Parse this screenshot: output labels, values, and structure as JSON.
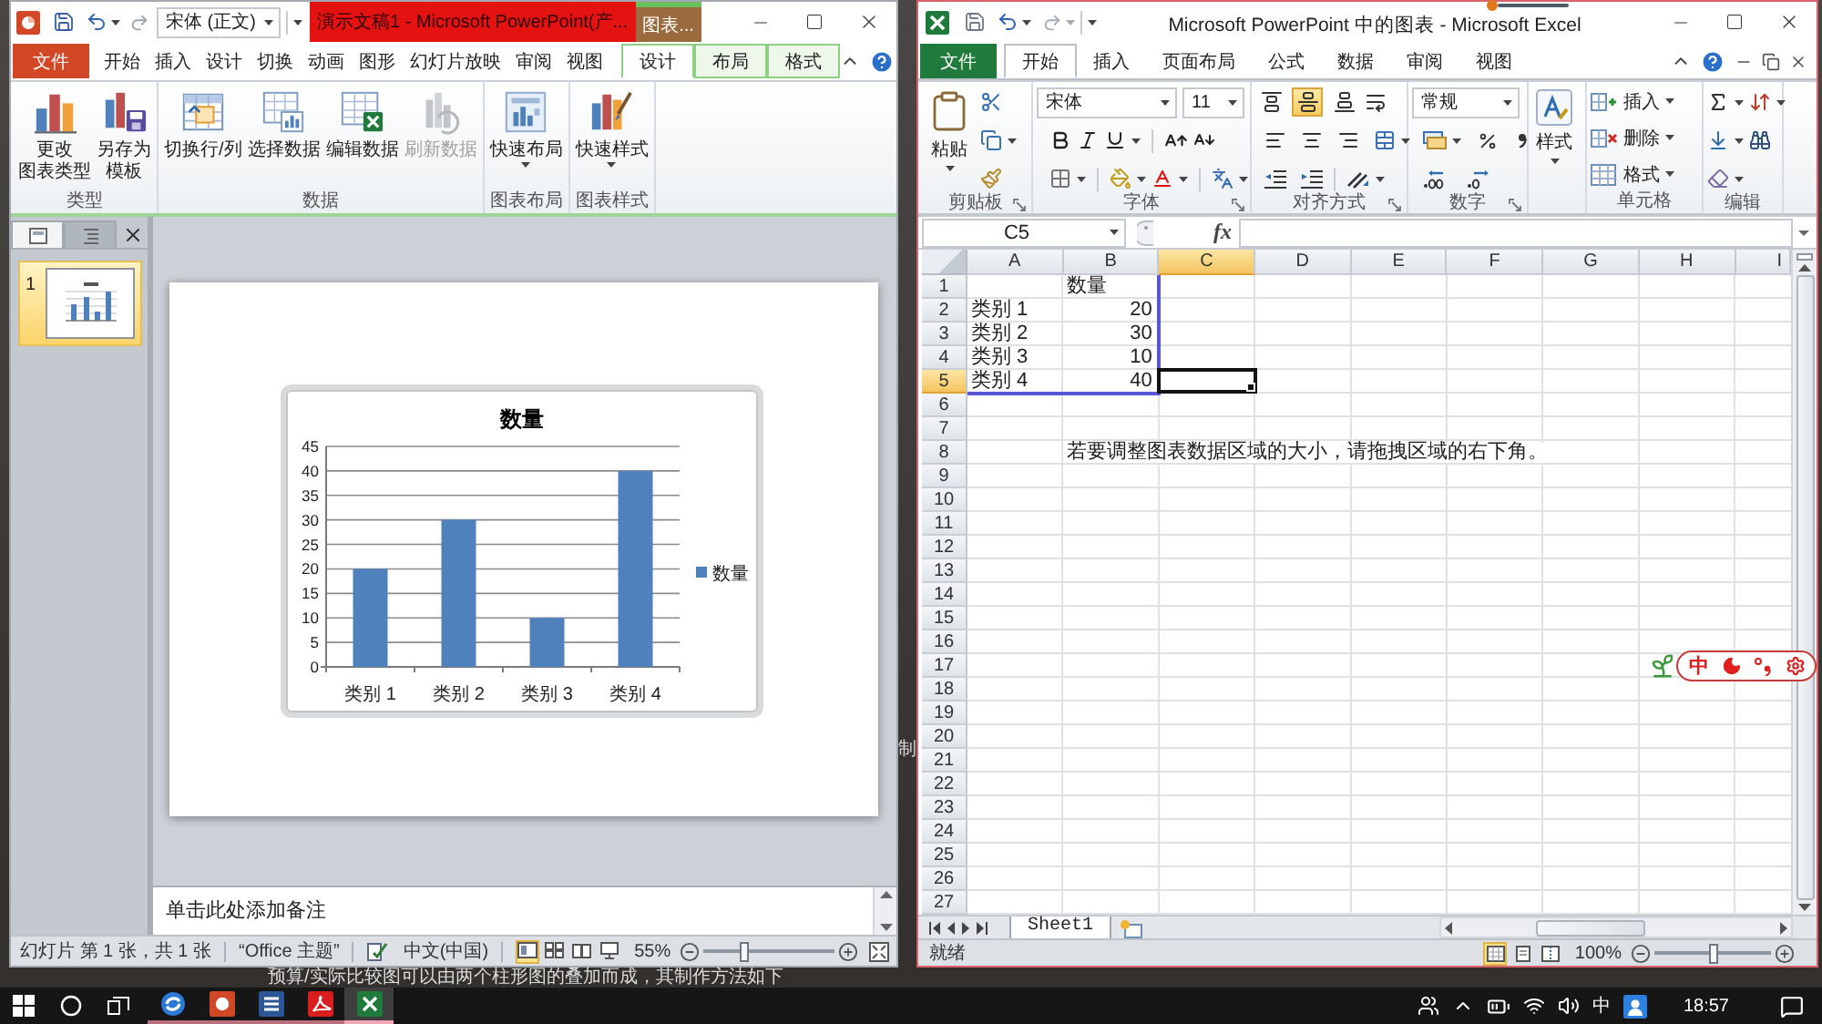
{
  "powerpoint": {
    "font_box": "宋体 (正文)",
    "title": "演示文稿1 - Microsoft PowerPoint(产...",
    "context_title": "图表...",
    "tabs": [
      {
        "label": "文件",
        "kind": "file",
        "selected": false
      },
      {
        "label": "开始",
        "kind": "main",
        "selected": false
      },
      {
        "label": "插入",
        "kind": "main",
        "selected": false
      },
      {
        "label": "设计",
        "kind": "main",
        "selected": false
      },
      {
        "label": "切换",
        "kind": "main",
        "selected": false
      },
      {
        "label": "动画",
        "kind": "main",
        "selected": false
      },
      {
        "label": "图形",
        "kind": "main",
        "selected": false
      },
      {
        "label": "幻灯片放映",
        "kind": "main",
        "selected": false
      },
      {
        "label": "审阅",
        "kind": "main",
        "selected": false
      },
      {
        "label": "视图",
        "kind": "main",
        "selected": false
      },
      {
        "label": "设计",
        "kind": "context",
        "selected": true
      },
      {
        "label": "布局",
        "kind": "context",
        "selected": false
      },
      {
        "label": "格式",
        "kind": "context",
        "selected": false
      }
    ],
    "ribbon_groups": [
      {
        "label": "类型",
        "buttons": [
          {
            "lines": [
              "更改",
              "图表类型"
            ],
            "dropdown": false,
            "disabled": false
          },
          {
            "lines": [
              "另存为",
              "模板"
            ],
            "dropdown": false,
            "disabled": false
          }
        ]
      },
      {
        "label": "数据",
        "buttons": [
          {
            "lines": [
              "切换行/列"
            ],
            "dropdown": false,
            "disabled": false
          },
          {
            "lines": [
              "选择数据"
            ],
            "dropdown": false,
            "disabled": false
          },
          {
            "lines": [
              "编辑数据"
            ],
            "dropdown": false,
            "disabled": false
          },
          {
            "lines": [
              "刷新数据"
            ],
            "dropdown": false,
            "disabled": true
          }
        ]
      },
      {
        "label": "图表布局",
        "buttons": [
          {
            "lines": [
              "快速布局"
            ],
            "dropdown": true,
            "disabled": false
          }
        ]
      },
      {
        "label": "图表样式",
        "buttons": [
          {
            "lines": [
              "快速样式"
            ],
            "dropdown": true,
            "disabled": false
          }
        ]
      }
    ],
    "pane_tabs": [
      {
        "selected": true
      },
      {
        "selected": false
      }
    ],
    "slides": [
      {
        "number": "1",
        "selected": true
      }
    ],
    "chart": {
      "chart_data": {
        "type": "bar",
        "title": "数量",
        "categories": [
          "类别 1",
          "类别 2",
          "类别 3",
          "类别 4"
        ],
        "series": [
          {
            "name": "数量",
            "color": "#4f81bd",
            "values": [
              20,
              30,
              10,
              40
            ]
          }
        ],
        "ylim": [
          0,
          45
        ],
        "yticks": [
          0,
          5,
          10,
          15,
          20,
          25,
          30,
          35,
          40,
          45
        ],
        "grid": true
      }
    },
    "notes": {
      "placeholder": "单击此处添加备注"
    },
    "status_bar": {
      "slide": "幻灯片 第 1 张，共 1 张",
      "theme": "“Office 主题”",
      "language": "中文(中国)",
      "views": [
        {
          "selected": true
        },
        {
          "selected": false
        },
        {
          "selected": false
        },
        {
          "selected": false
        }
      ],
      "zoom": "55%",
      "zoom_slider": {
        "level": 0.3
      }
    }
  },
  "excel": {
    "title": "Microsoft PowerPoint 中的图表 - Microsoft Excel",
    "tabs": [
      {
        "label": "文件",
        "kind": "file",
        "selected": false
      },
      {
        "label": "开始",
        "kind": "main",
        "selected": true
      },
      {
        "label": "插入",
        "kind": "main",
        "selected": false
      },
      {
        "label": "页面布局",
        "kind": "main",
        "selected": false
      },
      {
        "label": "公式",
        "kind": "main",
        "selected": false
      },
      {
        "label": "数据",
        "kind": "main",
        "selected": false
      },
      {
        "label": "审阅",
        "kind": "main",
        "selected": false
      },
      {
        "label": "视图",
        "kind": "main",
        "selected": false
      }
    ],
    "ribbon": {
      "clipboard": {
        "label": "剪贴板",
        "paste": "粘贴"
      },
      "font": {
        "label": "字体",
        "name": "宋体",
        "size": "11"
      },
      "alignment": {
        "label": "对齐方式",
        "vertical": [
          {
            "selected": false
          },
          {
            "selected": true
          },
          {
            "selected": false
          }
        ]
      },
      "number": {
        "label": "数字",
        "format": "常规"
      },
      "styles": {
        "button": "样式"
      },
      "cells": {
        "label": "单元格",
        "buttons": [
          "插入",
          "删除",
          "格式"
        ]
      },
      "editing": {
        "label": "编辑"
      }
    },
    "name_box": "C5",
    "function_button": "fx",
    "columns": [
      {
        "label": "A",
        "selected": false
      },
      {
        "label": "B",
        "selected": false
      },
      {
        "label": "C",
        "selected": true
      },
      {
        "label": "D",
        "selected": false
      },
      {
        "label": "E",
        "selected": false
      },
      {
        "label": "F",
        "selected": false
      },
      {
        "label": "G",
        "selected": false
      },
      {
        "label": "H",
        "selected": false
      },
      {
        "label": "I",
        "selected": false
      }
    ],
    "rows": [
      {
        "number": "1",
        "selected": false,
        "in_range": true,
        "cells": [
          null,
          {
            "text": "数量",
            "kind": "text"
          }
        ]
      },
      {
        "number": "2",
        "selected": false,
        "in_range": true,
        "cells": [
          {
            "text": "类别 1",
            "kind": "text"
          },
          {
            "text": "20",
            "kind": "number"
          }
        ]
      },
      {
        "number": "3",
        "selected": false,
        "in_range": true,
        "cells": [
          {
            "text": "类别 2",
            "kind": "text"
          },
          {
            "text": "30",
            "kind": "number"
          }
        ]
      },
      {
        "number": "4",
        "selected": false,
        "in_range": true,
        "cells": [
          {
            "text": "类别 3",
            "kind": "text"
          },
          {
            "text": "10",
            "kind": "number"
          }
        ]
      },
      {
        "number": "5",
        "selected": true,
        "in_range": true,
        "cells": [
          {
            "text": "类别 4",
            "kind": "text"
          },
          {
            "text": "40",
            "kind": "number"
          }
        ]
      },
      {
        "number": "6",
        "selected": false,
        "in_range": false
      },
      {
        "number": "7",
        "selected": false,
        "in_range": false
      },
      {
        "number": "8",
        "selected": false,
        "in_range": false,
        "cells": [
          null,
          {
            "text": "若要调整图表数据区域的大小，请拖拽区域的右下角。",
            "kind": "text"
          }
        ]
      },
      {
        "number": "9",
        "selected": false,
        "in_range": false
      },
      {
        "number": "10",
        "selected": false,
        "in_range": false
      },
      {
        "number": "11",
        "selected": false,
        "in_range": false
      },
      {
        "number": "12",
        "selected": false,
        "in_range": false
      },
      {
        "number": "13",
        "selected": false,
        "in_range": false
      },
      {
        "number": "14",
        "selected": false,
        "in_range": false
      },
      {
        "number": "15",
        "selected": false,
        "in_range": false
      },
      {
        "number": "16",
        "selected": false,
        "in_range": false
      },
      {
        "number": "17",
        "selected": false,
        "in_range": false
      },
      {
        "number": "18",
        "selected": false,
        "in_range": false
      },
      {
        "number": "19",
        "selected": false,
        "in_range": false
      },
      {
        "number": "20",
        "selected": false,
        "in_range": false
      },
      {
        "number": "21",
        "selected": false,
        "in_range": false
      },
      {
        "number": "22",
        "selected": false,
        "in_range": false
      },
      {
        "number": "23",
        "selected": false,
        "in_range": false
      },
      {
        "number": "24",
        "selected": false,
        "in_range": false
      },
      {
        "number": "25",
        "selected": false,
        "in_range": false
      },
      {
        "number": "26",
        "selected": false,
        "in_range": false
      },
      {
        "number": "27",
        "selected": false,
        "in_range": false
      }
    ],
    "sheets": [
      {
        "label": "Sheet1",
        "selected": true
      }
    ],
    "status_bar": {
      "ready": "就绪",
      "views": [
        {
          "selected": true
        },
        {
          "selected": false
        },
        {
          "selected": false
        }
      ],
      "zoom": "100%",
      "zoom_slider": {
        "level": 0.5
      }
    }
  },
  "ime_toolbar": {
    "mode": "中"
  },
  "background_page": {
    "side_text": "制",
    "bottom_text": "预算/实际比较图可以由两个柱形图的叠加而成，其制作方法如下"
  },
  "taskbar": {
    "apps": [
      {
        "selected": false
      },
      {
        "selected": false
      },
      {
        "selected": false
      },
      {
        "selected": false
      },
      {
        "selected": true
      }
    ],
    "input_mode": "中",
    "time": "18:57"
  }
}
